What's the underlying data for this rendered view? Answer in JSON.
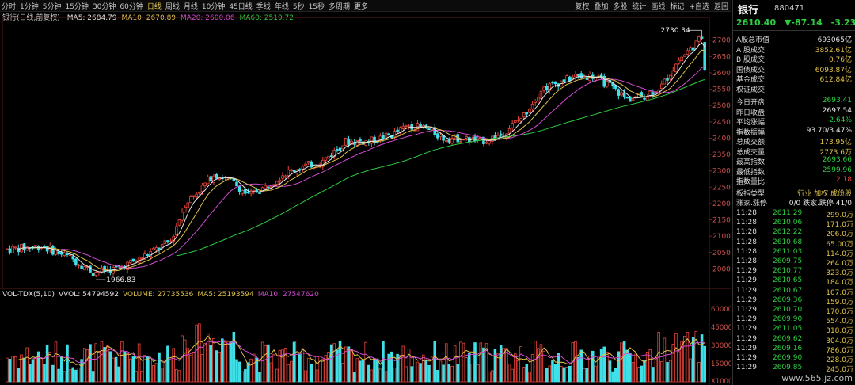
{
  "toolbar": {
    "periods": [
      "分时",
      "1分钟",
      "5分钟",
      "15分钟",
      "30分钟",
      "60分钟",
      "日线",
      "周线",
      "月线",
      "10分钟",
      "45日线",
      "季线",
      "年线",
      "5秒",
      "15秒",
      "多周期",
      "更多"
    ],
    "active_period": "日线",
    "tools": [
      "复权",
      "叠加",
      "多股",
      "统计",
      "画线",
      "标记",
      "+自选",
      "返回"
    ]
  },
  "ma_line": {
    "name": "银行(日线,前复权)",
    "items": [
      {
        "label": "MA5: 2684.79",
        "color": "#e6e6e6"
      },
      {
        "label": "MA10: 2670.89",
        "color": "#e0c34a"
      },
      {
        "label": "MA20: 2600.06",
        "color": "#d24bd2"
      },
      {
        "label": "MA60: 2519.72",
        "color": "#2ecc40"
      }
    ]
  },
  "vol_line": {
    "items": [
      {
        "label": "VOL-TDX(5,10)",
        "color": "#e6e6e6"
      },
      {
        "label": "VVOL: 54794592",
        "color": "#e6e6e6"
      },
      {
        "label": "VOLUME: 27735536",
        "color": "#e0c34a"
      },
      {
        "label": "MA5: 25193594",
        "color": "#e0c34a"
      },
      {
        "label": "MA10: 27547620",
        "color": "#d24bd2"
      }
    ]
  },
  "chart_data": {
    "type": "candlestick",
    "price_axis": {
      "ticks": [
        2000,
        2050,
        2100,
        2150,
        2200,
        2250,
        2300,
        2350,
        2400,
        2450,
        2500,
        2550,
        2600,
        2650,
        2700
      ]
    },
    "volume_axis": {
      "ticks": [
        15000,
        30000,
        45000,
        60000
      ],
      "unit": "X1000"
    },
    "annotations": [
      {
        "label": "2730.34",
        "value": 2730.34
      },
      {
        "label": "1966.83",
        "value": 1966.83
      }
    ],
    "colors": {
      "up": "#e8443a",
      "down": "#3fe0e8",
      "ma5": "#e6e6e6",
      "ma10": "#e0c34a",
      "ma20": "#d24bd2",
      "ma60": "#2ecc40"
    }
  },
  "quote": {
    "title": "银行",
    "code": "880471",
    "price": "2610.40",
    "change": "▼-87.14",
    "pct": "-3.23%"
  },
  "stats": [
    {
      "label": "A股总市值",
      "value": "693065亿",
      "color": "#e6e6e6"
    },
    {
      "label": "A 股成交",
      "value": "3852.61亿",
      "color": "#e0c34a"
    },
    {
      "label": "B 股成交",
      "value": "0.76亿",
      "color": "#e0c34a"
    },
    {
      "label": "国债成交",
      "value": "6093.87亿",
      "color": "#e0c34a"
    },
    {
      "label": "基金成交",
      "value": "612.84亿",
      "color": "#e0c34a"
    },
    {
      "label": "权证成交",
      "value": "",
      "color": "#e0c34a"
    },
    {
      "label": "今日开盘",
      "value": "2693.41",
      "color": "#2ecc40"
    },
    {
      "label": "昨日收盘",
      "value": "2697.54",
      "color": "#e6e6e6"
    },
    {
      "label": "平均涨幅",
      "value": "-2.64%",
      "color": "#2ecc40"
    },
    {
      "label": "指数振幅",
      "value": "93.70/3.47%",
      "color": "#e6e6e6"
    },
    {
      "label": "总成交额",
      "value": "173.95亿",
      "color": "#e0c34a"
    },
    {
      "label": "总成交量",
      "value": "2773.6万",
      "color": "#e0c34a"
    },
    {
      "label": "最高指数",
      "value": "2693.66",
      "color": "#2ecc40"
    },
    {
      "label": "最低指数",
      "value": "2599.96",
      "color": "#2ecc40"
    },
    {
      "label": "指数量比",
      "value": "2.18",
      "color": "#e8443a"
    },
    {
      "label": "板指类型",
      "value": "行业 加权 成份股",
      "color": "#e0c34a"
    },
    {
      "label": "涨家.涨停",
      "value": "0/0   跌家.跌停   41/0",
      "color": "#e6e6e6"
    }
  ],
  "ticks": [
    {
      "t": "11:28",
      "p": "2611.29",
      "q": "299.0万"
    },
    {
      "t": "11:28",
      "p": "2610.06",
      "q": "171.0万"
    },
    {
      "t": "11:28",
      "p": "2612.22",
      "q": "206.0万"
    },
    {
      "t": "11:28",
      "p": "2610.68",
      "q": "65.00万"
    },
    {
      "t": "11:28",
      "p": "2611.03",
      "q": "114.0万"
    },
    {
      "t": "11:28",
      "p": "2609.75",
      "q": "264.0万"
    },
    {
      "t": "11:29",
      "p": "2610.77",
      "q": "323.0万"
    },
    {
      "t": "11:29",
      "p": "2610.65",
      "q": "184.0万"
    },
    {
      "t": "11:29",
      "p": "2610.67",
      "q": "107.0万"
    },
    {
      "t": "11:29",
      "p": "2609.36",
      "q": "159.0万"
    },
    {
      "t": "11:29",
      "p": "2610.70",
      "q": "170.0万"
    },
    {
      "t": "11:29",
      "p": "2609.90",
      "q": "554.0万"
    },
    {
      "t": "11:29",
      "p": "2611.05",
      "q": "318.0万"
    },
    {
      "t": "11:29",
      "p": "2609.62",
      "q": "304.0万"
    },
    {
      "t": "11:29",
      "p": "2609.16",
      "q": "786.0万"
    },
    {
      "t": "11:29",
      "p": "2609.90",
      "q": "228.0万"
    },
    {
      "t": "11:29",
      "p": "2609.85",
      "q": "245.0万"
    }
  ],
  "watermark": "www.565.jz.com"
}
